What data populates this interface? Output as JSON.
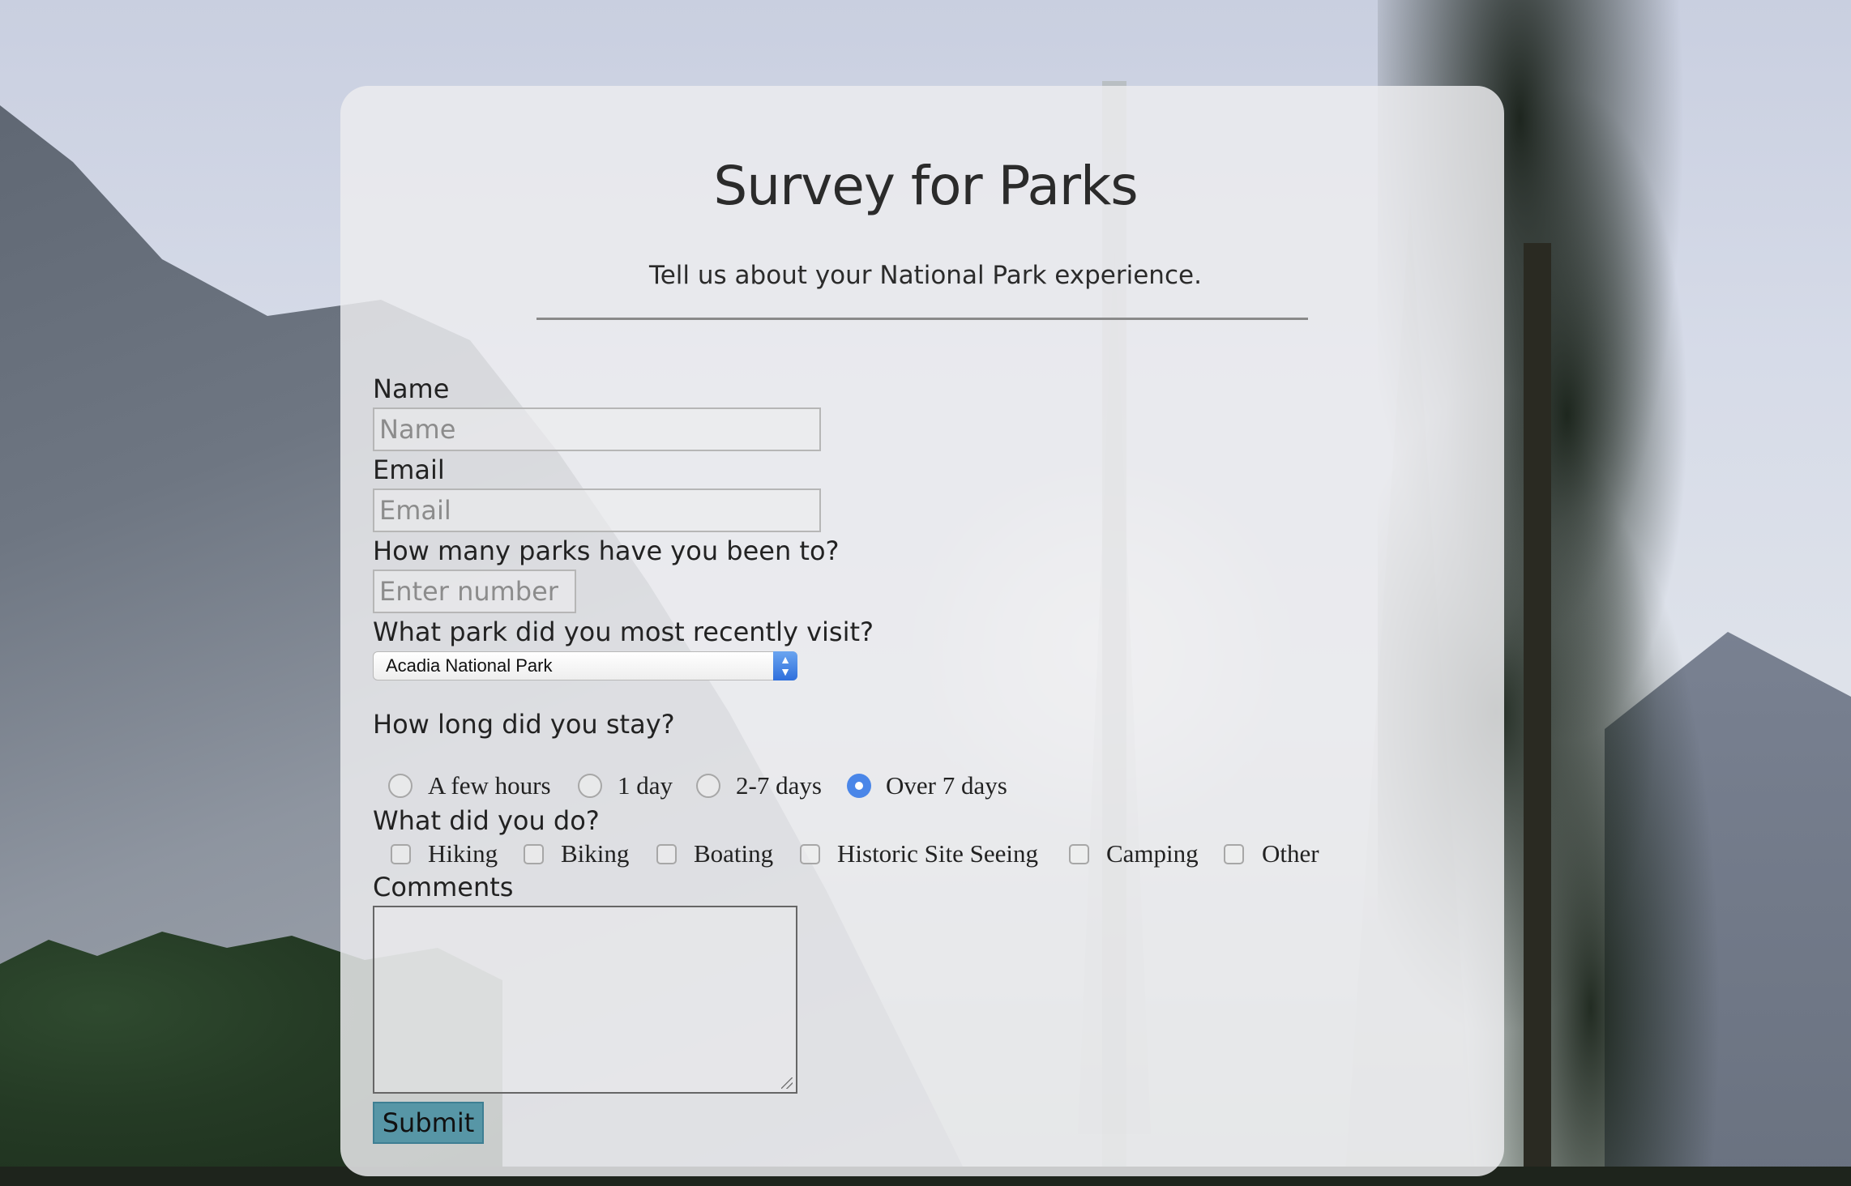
{
  "page": {
    "title": "Survey for Parks",
    "subtitle": "Tell us about your National Park experience."
  },
  "form": {
    "name": {
      "label": "Name",
      "placeholder": "Name",
      "value": ""
    },
    "email": {
      "label": "Email",
      "placeholder": "Email",
      "value": ""
    },
    "parks_count": {
      "label": "How many parks have you been to?",
      "placeholder": "Enter number",
      "value": ""
    },
    "recent_park": {
      "label": "What park did you most recently visit?",
      "selected": "Acadia National Park"
    },
    "stay": {
      "label": "How long did you stay?",
      "options": [
        "A few hours",
        "1 day",
        "2-7 days",
        "Over 7 days"
      ],
      "selected": "Over 7 days"
    },
    "activities": {
      "label": "What did you do?",
      "options": [
        "Hiking",
        "Biking",
        "Boating",
        "Historic Site Seeing",
        "Camping",
        "Other"
      ],
      "checked": []
    },
    "comments": {
      "label": "Comments",
      "value": ""
    },
    "submit_label": "Submit"
  },
  "colors": {
    "accent_radio": "#4a86e8",
    "submit_bg": "#5796a6",
    "card_bg": "rgba(236,236,238,0.84)"
  }
}
